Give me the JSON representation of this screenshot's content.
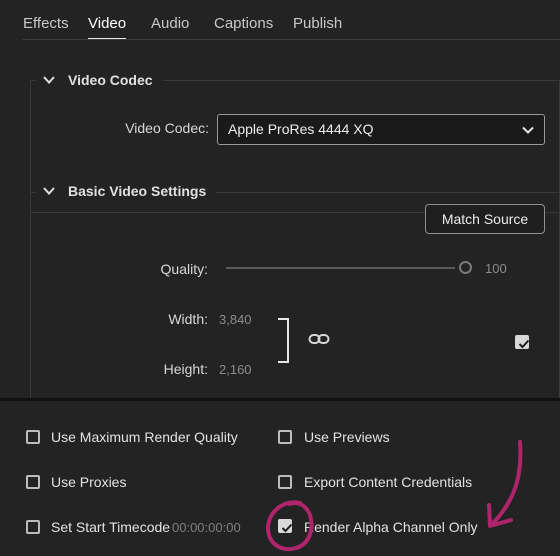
{
  "tabs": [
    {
      "label": "Effects",
      "active": false
    },
    {
      "label": "Video",
      "active": true
    },
    {
      "label": "Audio",
      "active": false
    },
    {
      "label": "Captions",
      "active": false
    },
    {
      "label": "Publish",
      "active": false
    }
  ],
  "video_codec_section": {
    "title": "Video Codec",
    "icon": "chevron-down-icon",
    "codec_label": "Video Codec:",
    "codec_value": "Apple ProRes 4444 XQ"
  },
  "basic_video_section": {
    "title": "Basic Video Settings",
    "icon": "chevron-down-icon",
    "match_source_label": "Match Source",
    "quality_label": "Quality:",
    "quality_value": "100",
    "quality_fraction": 1.0,
    "width_label": "Width:",
    "width_value": "3,840",
    "height_label": "Height:",
    "height_value": "2,160",
    "dimensions_linked": true,
    "right_checkbox_checked": true
  },
  "options": {
    "max_render_quality": {
      "label": "Use Maximum Render Quality",
      "checked": false
    },
    "use_previews": {
      "label": "Use Previews",
      "checked": false
    },
    "use_proxies": {
      "label": "Use Proxies",
      "checked": false
    },
    "content_credentials": {
      "label": "Export Content Credentials",
      "checked": false
    },
    "start_timecode": {
      "label": "Set Start Timecode",
      "checked": false,
      "timecode": "00:00:00:00"
    },
    "render_alpha": {
      "label": "Render Alpha Channel Only",
      "checked": true
    }
  },
  "colors": {
    "background": "#232323",
    "annotation": "#b0246c"
  }
}
